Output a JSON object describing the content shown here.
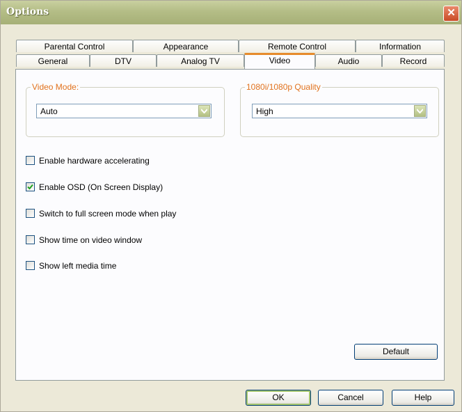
{
  "window": {
    "title": "Options"
  },
  "tabs": {
    "back_row": [
      "Parental Control",
      "Appearance",
      "Remote Control",
      "Information"
    ],
    "front_row": [
      "General",
      "DTV",
      "Analog TV",
      "Video",
      "Audio",
      "Record"
    ],
    "active": "Video"
  },
  "video_mode": {
    "label": "Video Mode:",
    "value": "Auto"
  },
  "quality": {
    "label": "1080i/1080p Quality",
    "value": "High"
  },
  "options": [
    {
      "label": "Enable hardware accelerating",
      "checked": false
    },
    {
      "label": "Enable OSD (On Screen Display)",
      "checked": true
    },
    {
      "label": "Switch to full screen mode when play",
      "checked": false
    },
    {
      "label": "Show time on video window",
      "checked": false
    },
    {
      "label": "Show left media time",
      "checked": false
    }
  ],
  "buttons": {
    "default": "Default",
    "ok": "OK",
    "cancel": "Cancel",
    "help": "Help"
  },
  "icons": {
    "close": "close-icon",
    "dropdown": "chevron-down-icon",
    "check": "checkmark-icon"
  },
  "colors": {
    "accent": "#e1721d",
    "checkmark": "#21a121",
    "title_bar": "#b4bd86"
  }
}
